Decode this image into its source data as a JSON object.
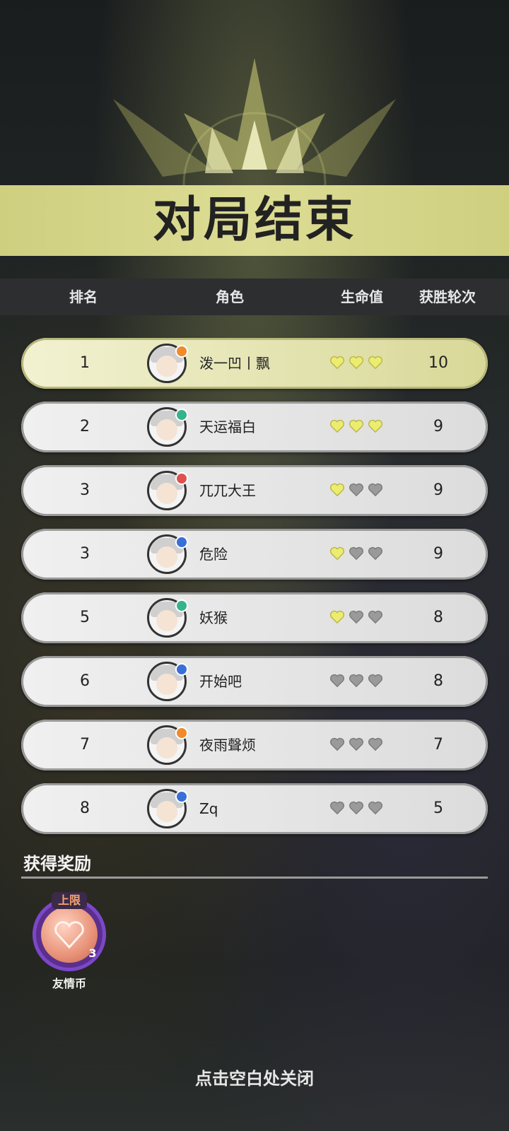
{
  "banner": {
    "title": "对局结束"
  },
  "header": {
    "rank": "排名",
    "character": "角色",
    "health": "生命值",
    "wins": "获胜轮次"
  },
  "rows": [
    {
      "rank": "1",
      "name": "泼一凹丨飘",
      "hearts_filled": 3,
      "wins": "10",
      "highlight": true,
      "badge_color": "#f08a2c"
    },
    {
      "rank": "2",
      "name": "天运福白",
      "hearts_filled": 3,
      "wins": "9",
      "highlight": false,
      "badge_color": "#36b38a"
    },
    {
      "rank": "3",
      "name": "兀兀大王",
      "hearts_filled": 1,
      "wins": "9",
      "highlight": false,
      "badge_color": "#e05050"
    },
    {
      "rank": "3",
      "name": "危险",
      "hearts_filled": 1,
      "wins": "9",
      "highlight": false,
      "badge_color": "#3a6fd8"
    },
    {
      "rank": "5",
      "name": "妖猴",
      "hearts_filled": 1,
      "wins": "8",
      "highlight": false,
      "badge_color": "#36b38a"
    },
    {
      "rank": "6",
      "name": "开始吧",
      "hearts_filled": 0,
      "wins": "8",
      "highlight": false,
      "badge_color": "#3a6fd8"
    },
    {
      "rank": "7",
      "name": "夜雨聲烦",
      "hearts_filled": 0,
      "wins": "7",
      "highlight": false,
      "badge_color": "#f08a2c"
    },
    {
      "rank": "8",
      "name": "Zq",
      "hearts_filled": 0,
      "wins": "5",
      "highlight": false,
      "badge_color": "#3a6fd8"
    }
  ],
  "rewards": {
    "title": "获得奖励",
    "item": {
      "limit_label": "上限",
      "count": "3",
      "name": "友情币"
    }
  },
  "footer": {
    "close_hint": "点击空白处关闭"
  },
  "colors": {
    "accent": "#d8d890",
    "heart_filled": "#ecec70",
    "heart_empty": "#9a9a9a"
  }
}
